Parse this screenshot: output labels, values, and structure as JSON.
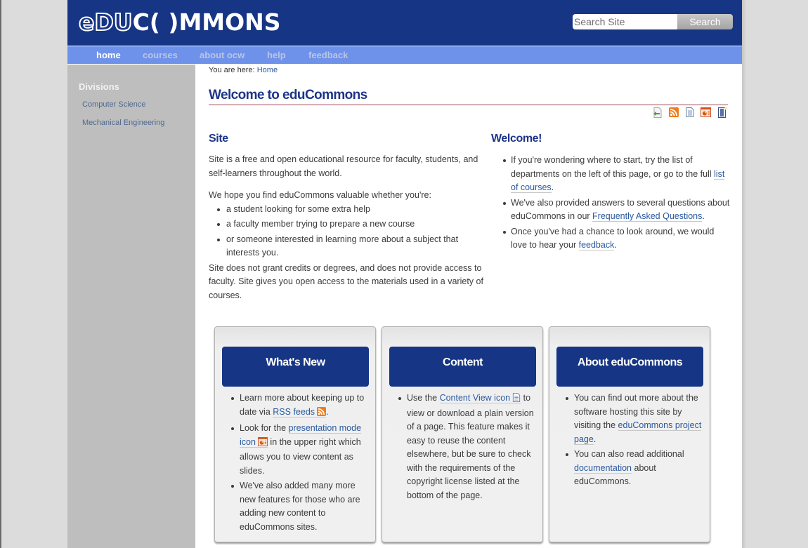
{
  "header": {
    "logo_text_outline": "eDU",
    "logo_text_solid": "C( )MMONS",
    "search_placeholder": "Search Site",
    "search_button": "Search"
  },
  "nav": {
    "items": [
      {
        "label": "home",
        "active": true
      },
      {
        "label": "courses",
        "active": false
      },
      {
        "label": "about ocw",
        "active": false
      },
      {
        "label": "help",
        "active": false
      },
      {
        "label": "feedback",
        "active": false
      }
    ]
  },
  "sidebar": {
    "title": "Divisions",
    "links": [
      "Computer Science",
      "Mechanical Engineering"
    ]
  },
  "breadcrumb": {
    "prefix": "You are here:",
    "current": "Home"
  },
  "page_title": "Welcome to eduCommons",
  "doc_actions": [
    "send-to-icon",
    "rss-icon",
    "content-view-icon",
    "presentation-mode-icon",
    "print-icon"
  ],
  "site": {
    "heading": "Site",
    "intro": "Site is a free and open educational resource for faculty, students, and self-learners throughout the world.",
    "hope": "We hope you find eduCommons valuable whether you're:",
    "bullets": [
      "a student looking for some extra help",
      "a faculty member trying to prepare a new course",
      "or someone interested in learning more about a subject that interests you."
    ],
    "closing": "Site does not grant credits or degrees, and does not provide access to faculty. Site gives you open access to the materials used in a variety of courses."
  },
  "welcome": {
    "heading": "Welcome!",
    "b1_text": "If you're wondering where to start, try the list of departments on the left of this page, or go to the full",
    "b1_link": "list of courses",
    "b2_text": "We've also provided answers to several questions about eduCommons in our",
    "b2_link": "Frequently Asked Questions",
    "b3_text": "Once you've had a chance to look around, we would love to hear your",
    "b3_link": "feedback",
    "period": "."
  },
  "boxes": {
    "whats_new": {
      "title": "What's New",
      "b1_text": "Learn more about keeping up to date via",
      "b1_link": "RSS feeds",
      "b2_text": "Look for the",
      "b2_link": "presentation mode icon",
      "b2_after": "in the upper right which allows you to view content as slides.",
      "b3_text": "We've also added many more new features for those who are adding new content to eduCommons sites."
    },
    "content": {
      "title": "Content",
      "b1_text": "Use the",
      "b1_link": "Content View icon",
      "b1_after": "to view or download a plain version of a page. This feature makes it easy to reuse the content elsewhere, but be sure to check with the requirements of the copyright license listed at the bottom of the page."
    },
    "about": {
      "title": "About eduCommons",
      "b1_text": "You can find out more about the software hosting this site by visiting the",
      "b1_link": "eduCommons project page",
      "b2_link": "documentation",
      "b2_before": "You can also read additional",
      "b2_after": "about eduCommons."
    }
  },
  "colors": {
    "header_bg": "#163585",
    "nav_bg": "#6e91ea",
    "sidebar_bg": "#bebebe",
    "heading": "#1d3588",
    "link": "#2a5aa0",
    "title_rule": "#9a4857"
  }
}
